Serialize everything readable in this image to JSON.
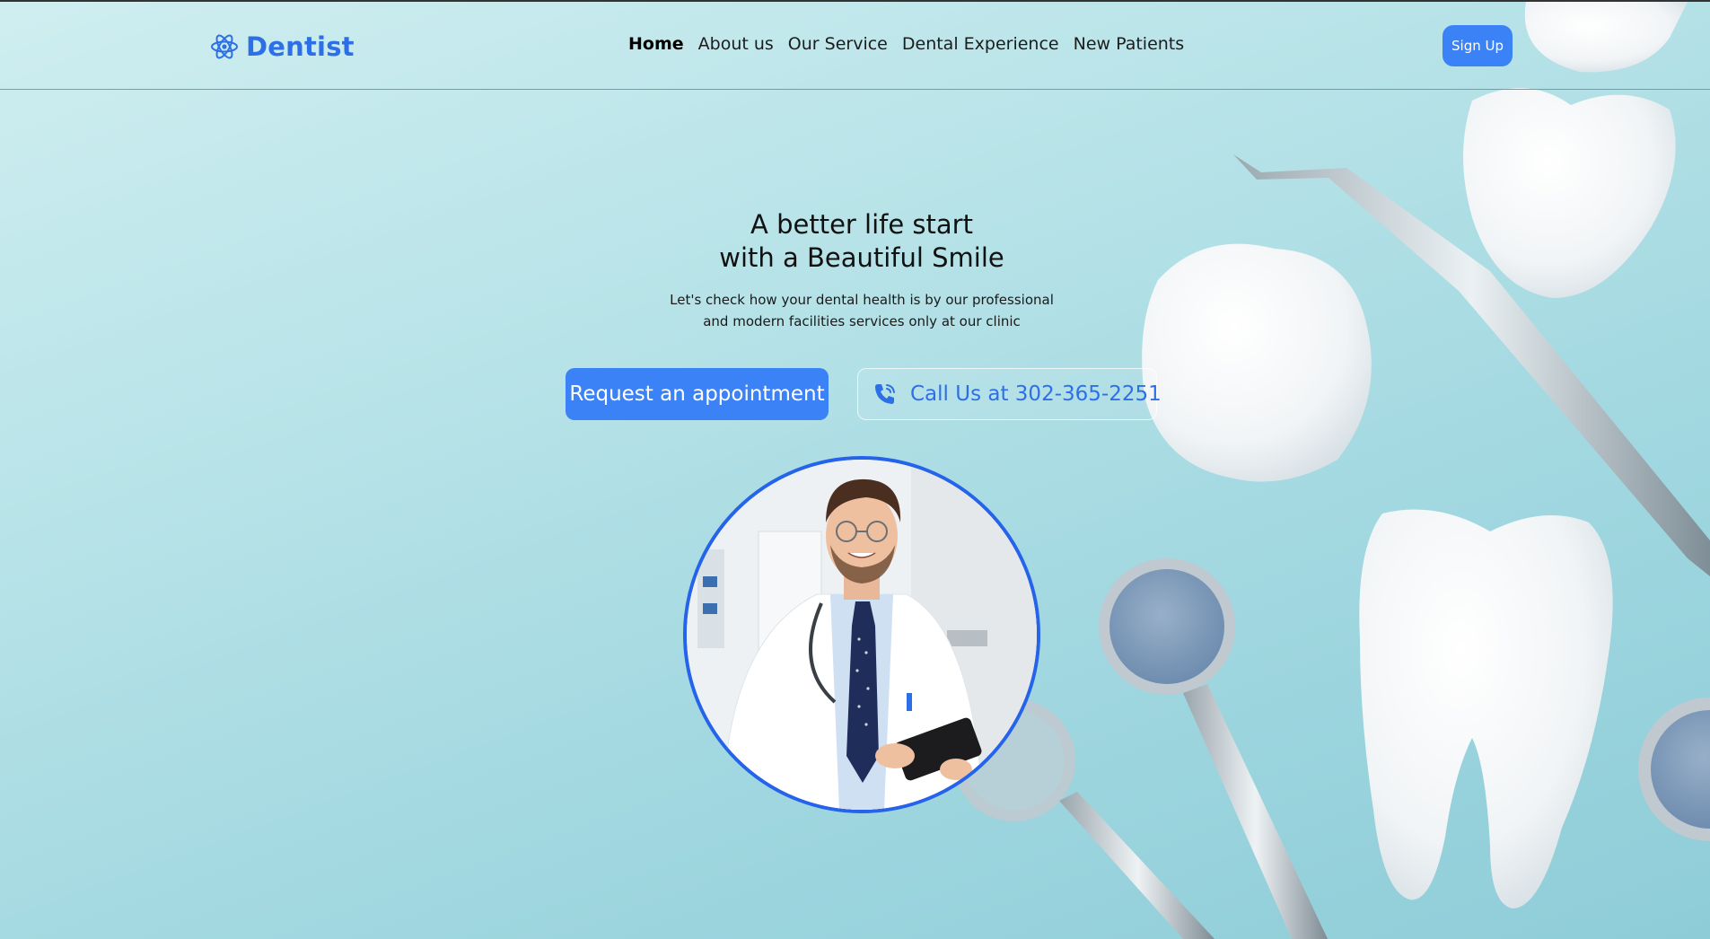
{
  "header": {
    "brand": {
      "name": "Dentist",
      "icon": "atom-icon"
    },
    "nav": [
      {
        "label": "Home",
        "active": true
      },
      {
        "label": "About us",
        "active": false
      },
      {
        "label": "Our Service",
        "active": false
      },
      {
        "label": "Dental Experience",
        "active": false
      },
      {
        "label": "New Patients",
        "active": false
      }
    ],
    "signup_label": "Sign Up"
  },
  "hero": {
    "title_line1": "A better life start",
    "title_line2": "with a Beautiful Smile",
    "subtitle_line1": "Let's check how your dental health is by our professional",
    "subtitle_line2": "and modern facilities services only at our clinic",
    "primary_button": "Request an appointment",
    "call_button": "Call Us at 302-365-2251",
    "call_icon": "phone-icon",
    "image": "doctor-photo"
  },
  "colors": {
    "accent": "#3b82f6",
    "brand": "#2d6fe6",
    "background": "#b7e3e8",
    "photo_ring": "#2563eb"
  }
}
